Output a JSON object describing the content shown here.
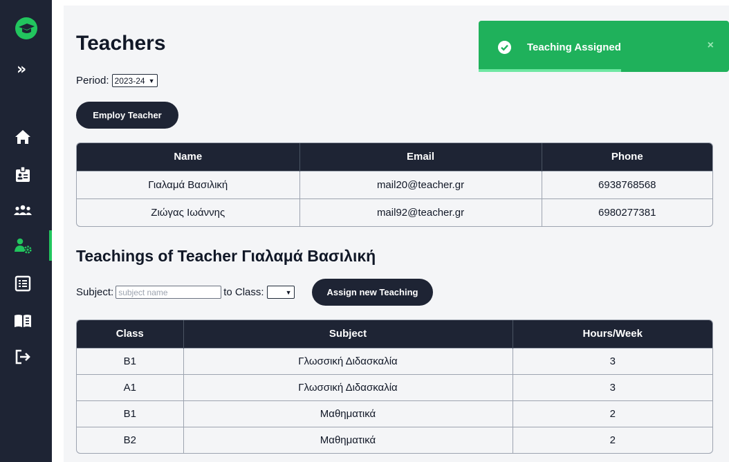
{
  "sidebar": {
    "expand_label": "»",
    "items": [
      {
        "name": "home",
        "icon": "home-icon"
      },
      {
        "name": "students",
        "icon": "id-badge-icon"
      },
      {
        "name": "users",
        "icon": "users-icon"
      },
      {
        "name": "teachers",
        "icon": "user-gear-icon",
        "active": true
      },
      {
        "name": "schedule",
        "icon": "table-list-icon"
      },
      {
        "name": "subjects",
        "icon": "book-open-icon"
      },
      {
        "name": "logout",
        "icon": "logout-icon"
      }
    ],
    "accent_color": "#22c55e",
    "bg_color": "#1e2434"
  },
  "page": {
    "title": "Teachers",
    "period_label": "Period:",
    "period_value": "2023-24",
    "employ_button": "Employ Teacher"
  },
  "teachers_table": {
    "columns": [
      "Name",
      "Email",
      "Phone"
    ],
    "rows": [
      [
        "Γιαλαμά Βασιλική",
        "mail20@teacher.gr",
        "6938768568"
      ],
      [
        "Ζιώγας Ιωάννης",
        "mail92@teacher.gr",
        "6980277381"
      ]
    ]
  },
  "teachings": {
    "title": "Teachings of Teacher Γιαλαμά Βασιλική",
    "subject_label": "Subject:",
    "subject_placeholder": "subject name",
    "to_class_label": "to Class:",
    "class_value": "",
    "assign_button": "Assign new Teaching",
    "columns": [
      "Class",
      "Subject",
      "Hours/Week"
    ],
    "rows": [
      [
        "B1",
        "Γλωσσική Διδασκαλία",
        "3"
      ],
      [
        "A1",
        "Γλωσσική Διδασκαλία",
        "3"
      ],
      [
        "B1",
        "Μαθηματικά",
        "2"
      ],
      [
        "B2",
        "Μαθηματικά",
        "2"
      ]
    ]
  },
  "toast": {
    "message": "Teaching Assigned",
    "close": "×",
    "icon": "check-circle-icon",
    "color": "#1fb15b",
    "progress": 0.57
  }
}
